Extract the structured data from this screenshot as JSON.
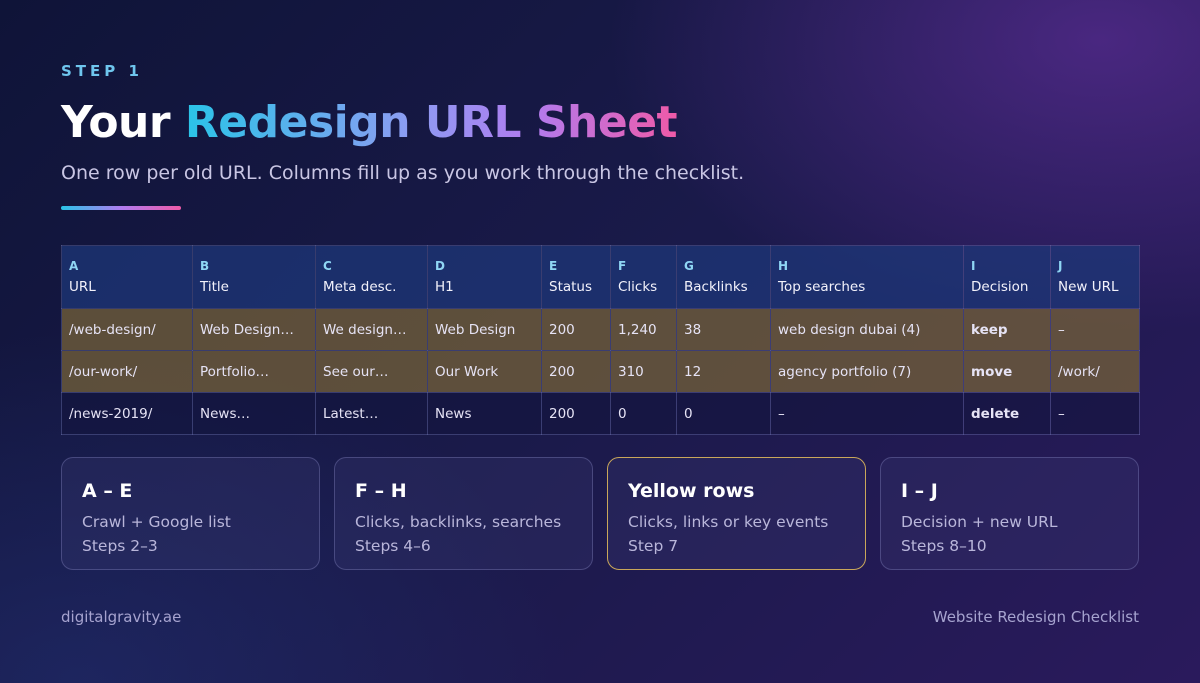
{
  "header": {
    "step": "STEP 1",
    "title_white": "Your",
    "title_gradient": "Redesign URL Sheet",
    "subtitle": "One row per old URL. Columns fill up as you work through the checklist."
  },
  "colors": {
    "accent_cyan": "#2ac4e8",
    "accent_purple": "#b07cf0",
    "accent_pink": "#ef5aa8",
    "yellow_row": "#786437",
    "highlight_border": "#c9a75a"
  },
  "table": {
    "columns": [
      {
        "letter": "A",
        "label": "URL"
      },
      {
        "letter": "B",
        "label": "Title"
      },
      {
        "letter": "C",
        "label": "Meta desc."
      },
      {
        "letter": "D",
        "label": "H1"
      },
      {
        "letter": "E",
        "label": "Status"
      },
      {
        "letter": "F",
        "label": "Clicks"
      },
      {
        "letter": "G",
        "label": "Backlinks"
      },
      {
        "letter": "H",
        "label": "Top searches"
      },
      {
        "letter": "I",
        "label": "Decision"
      },
      {
        "letter": "J",
        "label": "New URL"
      }
    ],
    "rows": [
      {
        "highlight": true,
        "cells": [
          "/web-design/",
          "Web Design…",
          "We design…",
          "Web Design",
          "200",
          "1,240",
          "38",
          "web design dubai (4)",
          "keep",
          "–"
        ]
      },
      {
        "highlight": true,
        "cells": [
          "/our-work/",
          "Portfolio…",
          "See our…",
          "Our Work",
          "200",
          "310",
          "12",
          "agency portfolio (7)",
          "move",
          "/work/"
        ]
      },
      {
        "highlight": false,
        "cells": [
          "/news-2019/",
          "News…",
          "Latest…",
          "News",
          "200",
          "0",
          "0",
          "–",
          "delete",
          "–"
        ]
      }
    ]
  },
  "cards": [
    {
      "title": "A – E",
      "line1": "Crawl + Google list",
      "line2": "Steps 2–3"
    },
    {
      "title": "F – H",
      "line1": "Clicks, backlinks, searches",
      "line2": "Steps 4–6"
    },
    {
      "title": "Yellow rows",
      "line1": "Clicks, links or key events",
      "line2": "Step 7"
    },
    {
      "title": "I – J",
      "line1": "Decision + new URL",
      "line2": "Steps 8–10"
    }
  ],
  "footer": {
    "left": "digitalgravity.ae",
    "right": "Website Redesign Checklist"
  }
}
